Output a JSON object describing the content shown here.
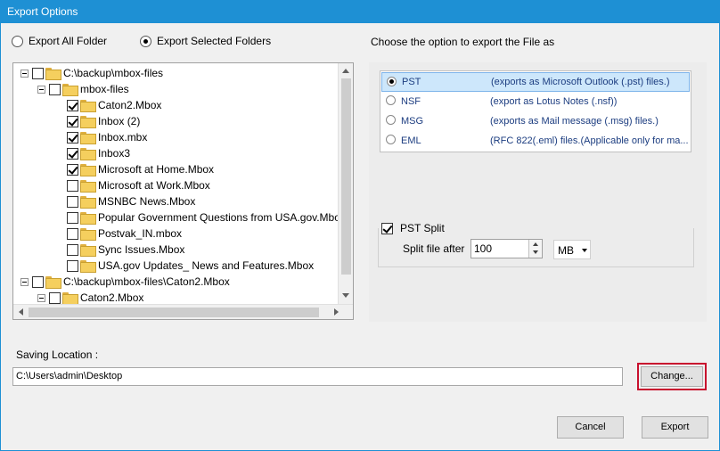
{
  "window": {
    "title": "Export Options"
  },
  "scope": {
    "all_label": "Export All Folder",
    "selected_label": "Export Selected Folders"
  },
  "tree": {
    "items": [
      {
        "label": "C:\\backup\\mbox-files",
        "checked": false
      },
      {
        "label": "mbox-files",
        "checked": false
      },
      {
        "label": "Caton2.Mbox",
        "checked": true
      },
      {
        "label": "Inbox (2)",
        "checked": true
      },
      {
        "label": "Inbox.mbx",
        "checked": true
      },
      {
        "label": "Inbox3",
        "checked": true
      },
      {
        "label": "Microsoft at Home.Mbox",
        "checked": true
      },
      {
        "label": "Microsoft at Work.Mbox",
        "checked": false
      },
      {
        "label": "MSNBC News.Mbox",
        "checked": false
      },
      {
        "label": "Popular Government Questions from USA.gov.Mbox",
        "checked": false
      },
      {
        "label": "Postvak_IN.mbox",
        "checked": false
      },
      {
        "label": "Sync Issues.Mbox",
        "checked": false
      },
      {
        "label": "USA.gov Updates_ News and Features.Mbox",
        "checked": false
      },
      {
        "label": "C:\\backup\\mbox-files\\Caton2.Mbox",
        "checked": false
      },
      {
        "label": "Caton2.Mbox",
        "checked": false
      }
    ]
  },
  "format": {
    "heading": "Choose the option to export the File as",
    "options": [
      {
        "name": "PST",
        "desc": "(exports as Microsoft Outlook (.pst) files.)",
        "selected": true
      },
      {
        "name": "NSF",
        "desc": "(export as Lotus Notes (.nsf))",
        "selected": false
      },
      {
        "name": "MSG",
        "desc": "(exports as Mail message (.msg) files.)",
        "selected": false
      },
      {
        "name": "EML",
        "desc": "(RFC 822(.eml) files.(Applicable only for ma...",
        "selected": false
      }
    ]
  },
  "split": {
    "label": "PST Split",
    "checked": true,
    "after_label": "Split file after",
    "value": "100",
    "unit": "MB"
  },
  "saving": {
    "label": "Saving Location :",
    "path": "C:\\Users\\admin\\Desktop",
    "change_label": "Change..."
  },
  "footer": {
    "cancel_label": "Cancel",
    "export_label": "Export"
  }
}
